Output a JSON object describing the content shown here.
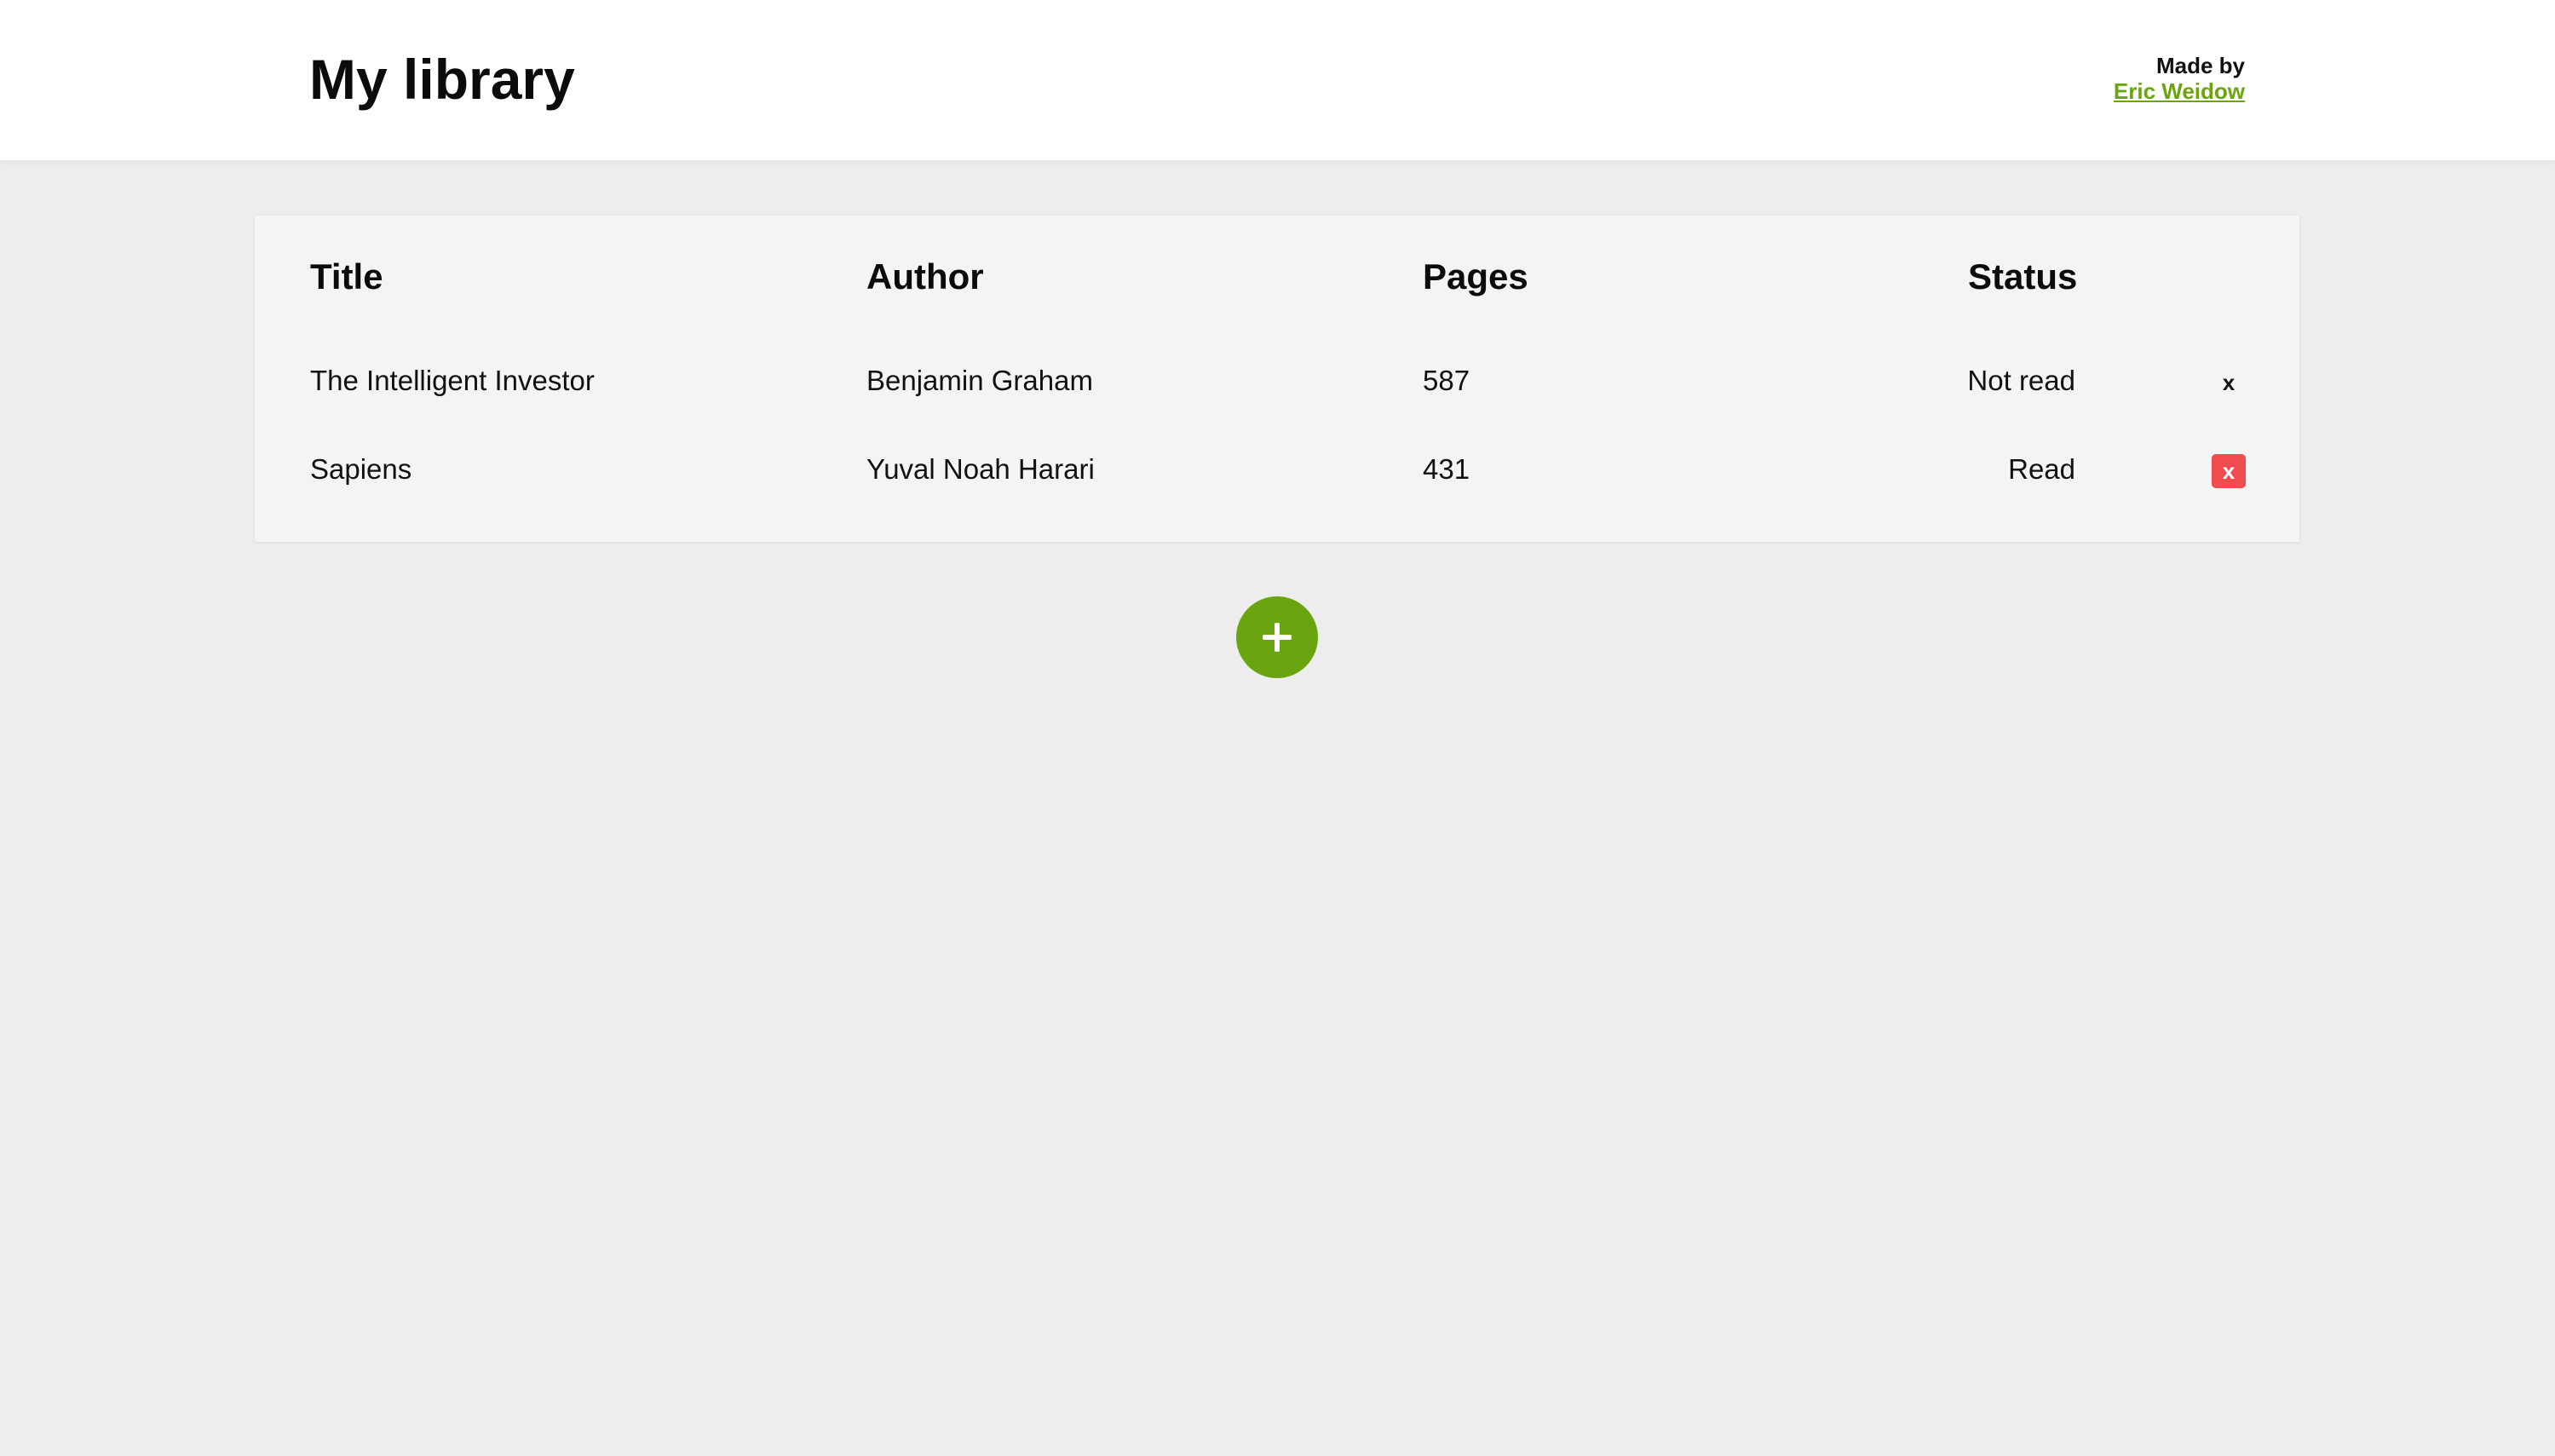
{
  "header": {
    "title": "My library",
    "credit_label": "Made by",
    "credit_link": "Eric Weidow"
  },
  "table": {
    "columns": [
      "Title",
      "Author",
      "Pages",
      "Status"
    ],
    "rows": [
      {
        "title": "The Intelligent Investor",
        "author": "Benjamin Graham",
        "pages": "587",
        "status": "Not read",
        "remove_label": "x"
      },
      {
        "title": "Sapiens",
        "author": "Yuval Noah Harari",
        "pages": "431",
        "status": "Read",
        "remove_label": "x"
      }
    ]
  },
  "add_button": {
    "icon": "plus-icon"
  },
  "colors": {
    "accent": "#6aa510",
    "danger": "#f04b4f",
    "page_background": "#ededed",
    "card_background": "#f4f4f4"
  }
}
